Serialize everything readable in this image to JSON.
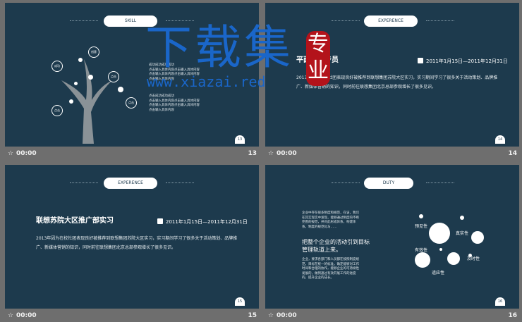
{
  "slides": [
    {
      "pill": "SKILL",
      "number": "13",
      "page": "13",
      "time": "00:00",
      "skill_nodes": [
        "成功",
        "创意",
        "点击",
        "点击",
        "点击"
      ],
      "skill_text_1": "成功成功成功成功\n点击输入具体内容点击输入具体内容\n点击输入具体内容点击输入具体内容\n点击输入具体内容",
      "skill_text_2": "点击成功成功成功\n点击输入具体内容点击输入具体内容\n点击输入具体内容点击输入具体内容\n点击输入具体内容"
    },
    {
      "pill": "EXPERENCE",
      "number": "14",
      "page": "14",
      "time": "00:00",
      "title": "平面设计专员",
      "date": "2011年1月15日—2011年12月31日",
      "body": "2013年因为在校社团表现良好被推荐到联想集团苏院大区实习，实习期间学习了很多关于活动策划、品牌推广、新媒体营销的知识，同时前往联想集团北京总部参观增长了很多见识。"
    },
    {
      "pill": "EXPERENCE",
      "number": "15",
      "page": "15",
      "time": "00:00",
      "title": "联想苏院大区推广部实习",
      "date": "2011年1月15日—2011年12月31日",
      "body": "2013年因为在校社团表现良好被推荐到联想集团苏院大区实习，实习期间学习了很多关于活动策划、品牌推广、新媒体营销的知识，同时前往联想集团北京总部参观增长了很多见识。"
    },
    {
      "pill": "DUTY",
      "number": "16",
      "page": "16",
      "time": "00:00",
      "duty_intro": "企业中存在很多制度和规范，在该，我们在其实现实中发现，能够通过制度的不断完善的规范，并对此形成体系，构建体系，制度的规范化与……",
      "duty_heading": "把整个企业的活动引到目标管理轨道上来。",
      "duty_text": "企业，要求各部门和人员都在按照制度规范，目标在统一的标准，确定能够对工作时间和合理的协作，能够企业的可持续性发展的，做到通过有效开展工作的进度的，提升企业的成长。",
      "duty_labels": [
        "预见性",
        "真实性",
        "有效性",
        "及时性",
        "适应性"
      ]
    }
  ],
  "watermark": {
    "text": "下载集",
    "badge": "专业",
    "url": "www.xiazai.red"
  },
  "colors": {
    "slide_bg": "#1d3a4d",
    "panel_bg": "#6e6e6e",
    "watermark": "#1a66c9",
    "badge": "#b3131b"
  }
}
